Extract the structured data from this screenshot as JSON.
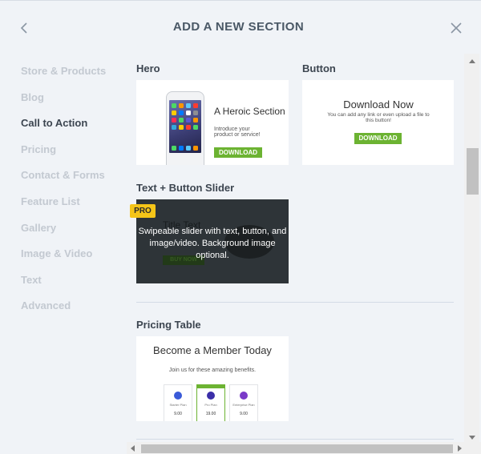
{
  "header": {
    "title": "ADD A NEW SECTION"
  },
  "sidebar": {
    "items": [
      {
        "label": "Store & Products"
      },
      {
        "label": "Blog"
      },
      {
        "label": "Call to Action"
      },
      {
        "label": "Pricing"
      },
      {
        "label": "Contact & Forms"
      },
      {
        "label": "Feature List"
      },
      {
        "label": "Gallery"
      },
      {
        "label": "Image & Video"
      },
      {
        "label": "Text"
      },
      {
        "label": "Advanced"
      }
    ],
    "active": "Call to Action"
  },
  "sections": {
    "hero": {
      "title": "Hero",
      "heading": "A Heroic Section",
      "subtext": "Introduce your product or service!",
      "button": "DOWNLOAD"
    },
    "button": {
      "title": "Button",
      "heading": "Download Now",
      "subtext": "You can add any link or even upload a file to this button!",
      "button": "DOWNLOAD"
    },
    "slider": {
      "title": "Text + Button Slider",
      "badge": "PRO",
      "bg_title": "Title Text",
      "bg_button": "BUY NOW",
      "description": "Swipeable slider with text, button, and image/video. Background image optional."
    },
    "pricing": {
      "title": "Pricing Table",
      "heading": "Become a Member Today",
      "subtext": "Join us for these amazing benefits.",
      "plans": [
        {
          "name": "Starter Plan",
          "price": "9.00"
        },
        {
          "name": "Pro Plan",
          "price": "19.00"
        },
        {
          "name": "Enterprise Plan",
          "price": "9.00"
        }
      ]
    }
  },
  "colors": {
    "accent_green": "#6cb332",
    "pro_badge": "#f5c518",
    "panel_bg": "#f0f3f7",
    "sidebar_inactive": "#c3c9d1",
    "sidebar_active": "#3c4550"
  },
  "icons": {
    "back": "chevron-left-icon",
    "close": "close-icon",
    "scroll_up": "arrow-up-icon",
    "scroll_down": "arrow-down-icon",
    "scroll_left": "arrow-left-icon",
    "scroll_right": "arrow-right-icon"
  }
}
